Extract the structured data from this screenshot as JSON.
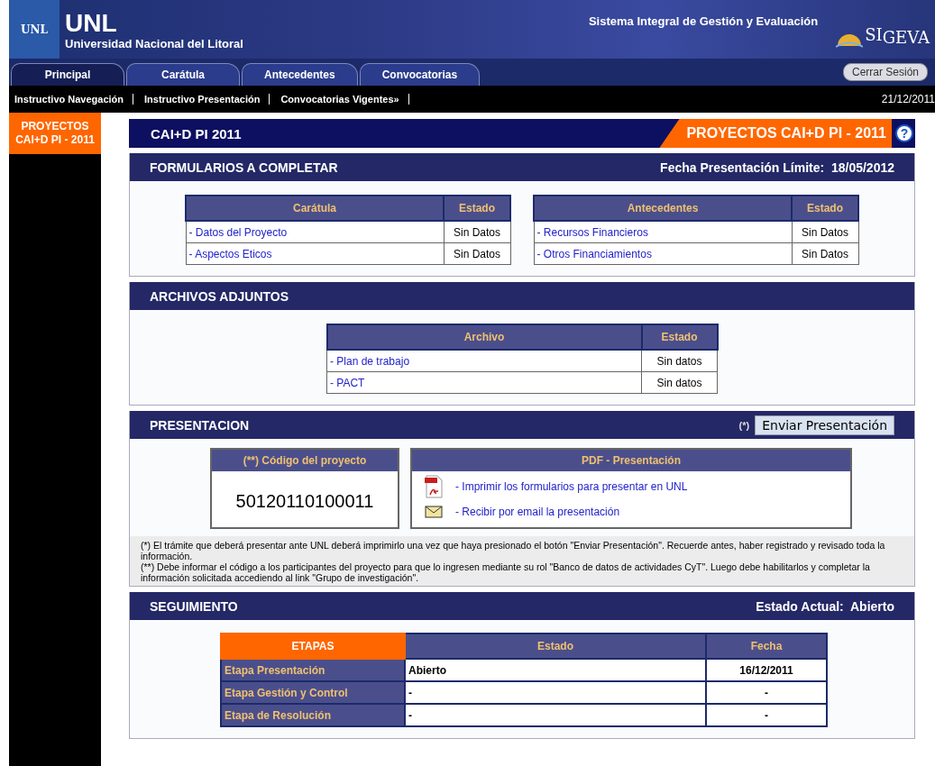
{
  "header": {
    "logo_small": "UNL",
    "logo_big": "UNL",
    "university": "Universidad Nacional del Litoral",
    "system": "Sistema Integral de Gestión y Evaluación",
    "brand_si": "SI",
    "brand_geva": "GEVA"
  },
  "tabs": [
    {
      "label": "Principal",
      "selected": true
    },
    {
      "label": "Carátula",
      "selected": false
    },
    {
      "label": "Antecedentes",
      "selected": false
    },
    {
      "label": "Convocatorias",
      "selected": false
    }
  ],
  "logout": "Cerrar Sesión",
  "subnav": [
    "Instructivo Navegación",
    "Instructivo Presentación",
    "Convocatorias Vigentes»"
  ],
  "date": "21/12/2011",
  "sidebar": {
    "items": [
      {
        "label": "PROYECTOS CAI+D PI - 2011",
        "selected": true
      }
    ]
  },
  "title_bar": {
    "left": "CAI+D PI 2011",
    "right": "PROYECTOS CAI+D PI - 2011",
    "help": "?"
  },
  "formularios": {
    "title": "FORMULARIOS A COMPLETAR",
    "deadline": "Fecha Presentación Límite:  18/05/2012",
    "tables": [
      {
        "columns": [
          "Carátula",
          "Estado"
        ],
        "rows": [
          {
            "name": "- Datos del Proyecto",
            "status": "Sin Datos"
          },
          {
            "name": "- Aspectos Eticos",
            "status": "Sin Datos"
          }
        ]
      },
      {
        "columns": [
          "Antecedentes",
          "Estado"
        ],
        "rows": [
          {
            "name": "- Recursos Financieros",
            "status": "Sin Datos"
          },
          {
            "name": "- Otros Financiamientos",
            "status": "Sin Datos"
          }
        ]
      }
    ]
  },
  "archivos": {
    "title": "ARCHIVOS ADJUNTOS",
    "columns": [
      "Archivo",
      "Estado"
    ],
    "rows": [
      {
        "name": "- Plan de trabajo",
        "status": "Sin datos"
      },
      {
        "name": "- PACT",
        "status": "Sin datos"
      }
    ]
  },
  "presentacion": {
    "title": "PRESENTACION",
    "mark": "(*)",
    "button": "Enviar Presentación",
    "code_title": "(**) Código del proyecto",
    "code": "50120110100011",
    "pdf_title": "PDF - Presentación",
    "links": [
      {
        "kind": "pdf",
        "label": "- Imprimir los formularios para presentar en UNL"
      },
      {
        "kind": "email",
        "label": "- Recibir por email la presentación"
      }
    ],
    "notes": [
      "(*) El trámite que deberá presentar ante UNL deberá imprimirlo una vez que haya presionado el botón \"Enviar Presentación\". Recuerde antes, haber registrado y revisado toda la información.",
      "(**) Debe informar el código a los participantes del proyecto para que lo ingresen mediante su rol \"Banco de datos de actividades CyT\". Luego debe habilitarlos y completar la información solicitada accediendo al link \"Grupo de investigación\"."
    ]
  },
  "seguimiento": {
    "title": "SEGUIMIENTO",
    "status": "Estado Actual:  Abierto",
    "columns": [
      "ETAPAS",
      "Estado",
      "Fecha"
    ],
    "rows": [
      {
        "stage": "Etapa Presentación",
        "state": "Abierto",
        "date": "16/12/2011"
      },
      {
        "stage": "Etapa Gestión y Control",
        "state": "-",
        "date": "-"
      },
      {
        "stage": "Etapa de Resolución",
        "state": "-",
        "date": "-"
      }
    ]
  }
}
